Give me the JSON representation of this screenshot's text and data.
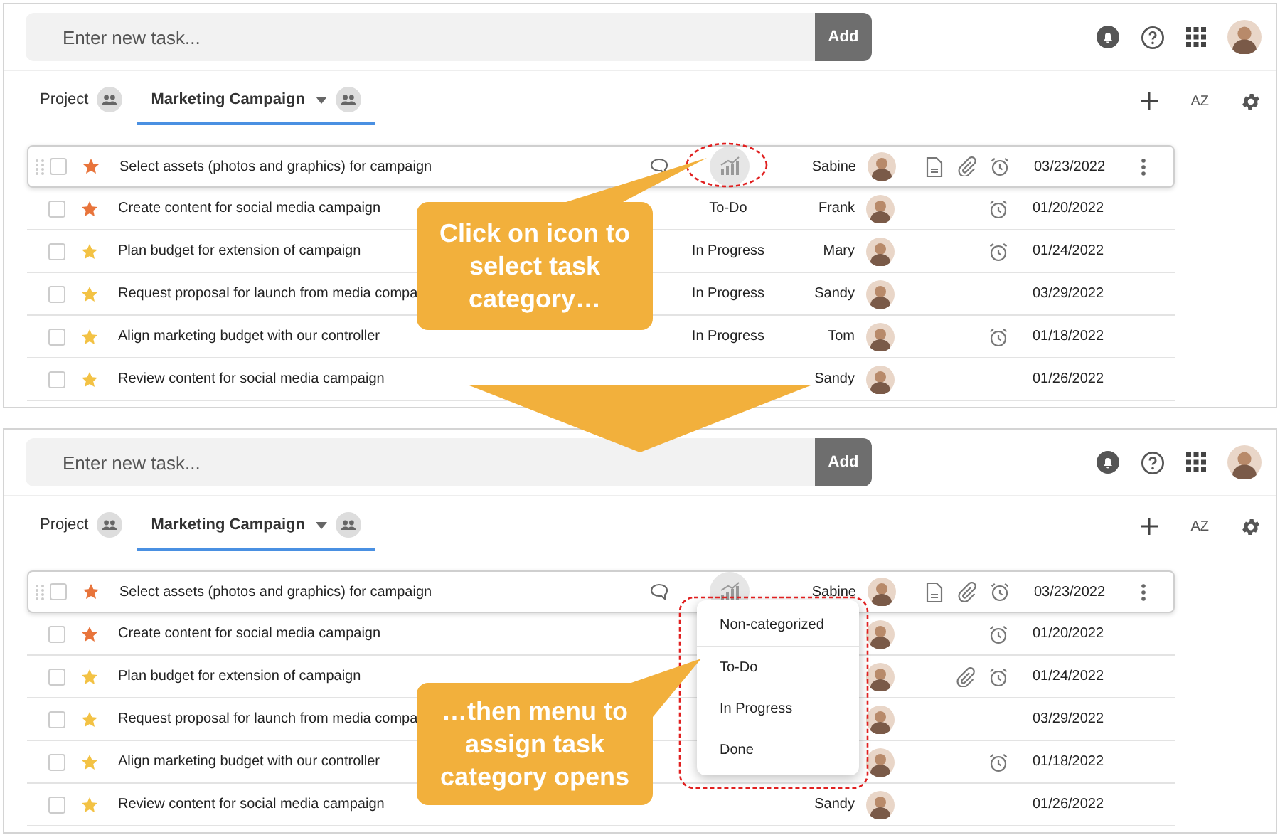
{
  "panels": [
    {
      "new_task": {
        "placeholder": "Enter new task...",
        "button": "Add"
      },
      "sort_label": "AZ",
      "tabs": [
        {
          "label": "Project",
          "selected": false,
          "dropdown": false
        },
        {
          "label": "Marketing Campaign",
          "selected": true,
          "dropdown": true
        }
      ],
      "rows": [
        {
          "title": "Select assets (photos and graphics) for campaign",
          "selected": true,
          "color": "#e8743b",
          "assignee": "Sabine",
          "note": true,
          "attachment": true,
          "reminder": true,
          "date": "03/23/2022"
        },
        {
          "title": "Create content for social media campaign",
          "selected": false,
          "color": "#e8743b",
          "status": "To-Do",
          "assignee": "Frank",
          "note": false,
          "attachment": false,
          "reminder": true,
          "date": "01/20/2022"
        },
        {
          "title": "Plan budget for extension of campaign",
          "selected": false,
          "color": "#f3c244",
          "status": "In Progress",
          "assignee": "Mary",
          "note": false,
          "attachment": false,
          "reminder": true,
          "date": "01/24/2022"
        },
        {
          "title": "Request proposal for launch from media compa",
          "selected": false,
          "color": "#f3c244",
          "status": "In Progress",
          "assignee": "Sandy",
          "note": false,
          "attachment": false,
          "reminder": false,
          "date": "03/29/2022"
        },
        {
          "title": "Align marketing budget with our controller",
          "selected": false,
          "color": "#f3c244",
          "status": "In Progress",
          "assignee": "Tom",
          "note": false,
          "attachment": false,
          "reminder": true,
          "date": "01/18/2022"
        },
        {
          "title": "Review content for social media campaign",
          "selected": false,
          "color": "#f3c244",
          "assignee": "Sandy",
          "note": false,
          "attachment": false,
          "reminder": false,
          "date": "01/26/2022"
        }
      ]
    },
    {
      "new_task": {
        "placeholder": "Enter new task...",
        "button": "Add"
      },
      "sort_label": "AZ",
      "tabs": [
        {
          "label": "Project",
          "selected": false,
          "dropdown": false
        },
        {
          "label": "Marketing Campaign",
          "selected": true,
          "dropdown": true
        }
      ],
      "rows": [
        {
          "title": "Select assets (photos and graphics) for campaign",
          "selected": true,
          "color": "#e8743b",
          "assignee": "Sabine",
          "note": true,
          "attachment": true,
          "reminder": true,
          "date": "03/23/2022"
        },
        {
          "title": "Create content for social media campaign",
          "selected": false,
          "color": "#e8743b",
          "note": false,
          "attachment": false,
          "reminder": true,
          "date": "01/20/2022"
        },
        {
          "title": "Plan budget for extension of campaign",
          "selected": false,
          "color": "#f3c244",
          "note": false,
          "attachment": true,
          "reminder": true,
          "date": "01/24/2022"
        },
        {
          "title": "Request proposal for launch from media compa",
          "selected": false,
          "color": "#f3c244",
          "note": false,
          "attachment": false,
          "reminder": false,
          "date": "03/29/2022"
        },
        {
          "title": "Align marketing budget with our controller",
          "selected": false,
          "color": "#f3c244",
          "note": false,
          "attachment": false,
          "reminder": true,
          "date": "01/18/2022"
        },
        {
          "title": "Review content for social media campaign",
          "selected": false,
          "color": "#f3c244",
          "assignee": "Sandy",
          "note": false,
          "attachment": false,
          "reminder": false,
          "date": "01/26/2022"
        }
      ],
      "category_menu": {
        "items": [
          {
            "label": "Non-categorized"
          },
          {
            "label": "To-Do"
          },
          {
            "label": "In Progress"
          },
          {
            "label": "Done"
          }
        ]
      }
    }
  ],
  "callouts": [
    {
      "text": "Click on icon to select task category…"
    },
    {
      "text": "…then menu to assign task category opens"
    }
  ]
}
